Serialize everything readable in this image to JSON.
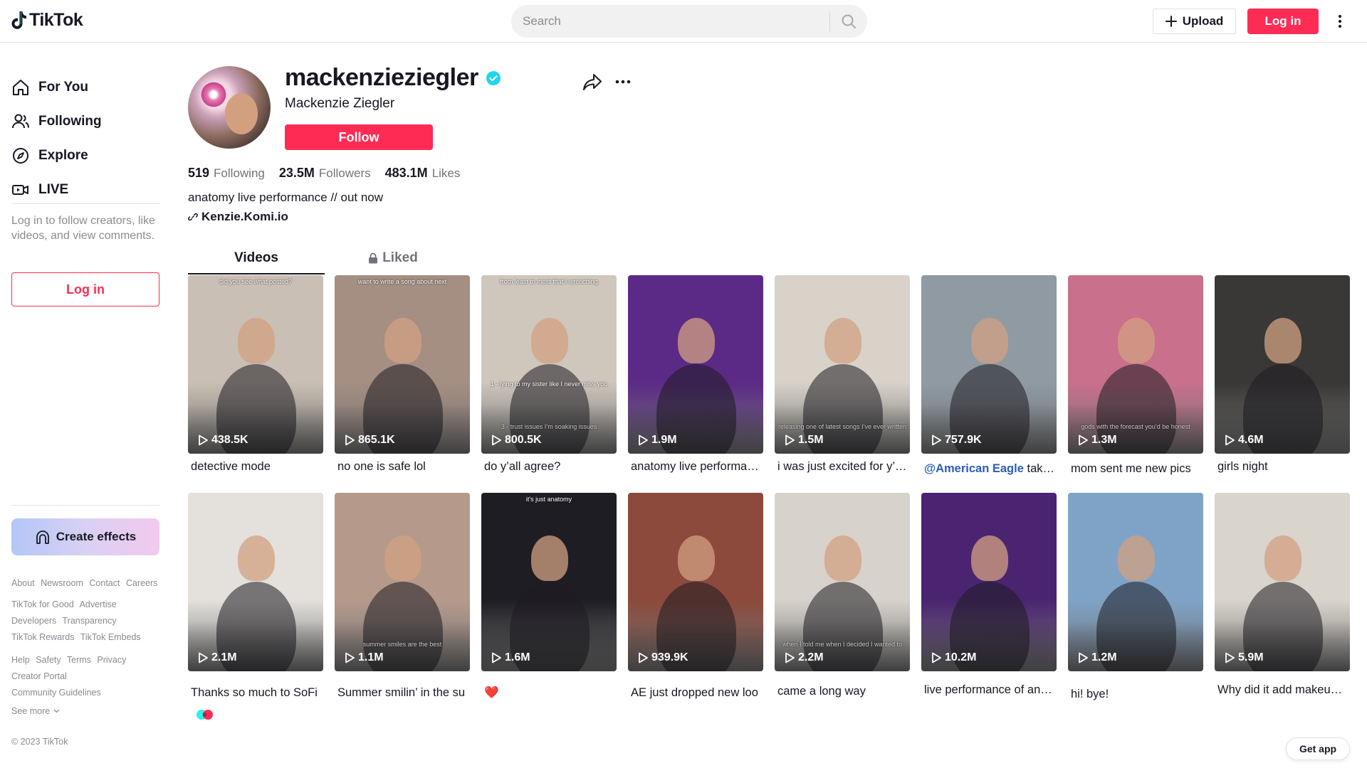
{
  "header": {
    "logo_text": "TikTok",
    "search_placeholder": "Search",
    "upload_label": "Upload",
    "login_label": "Log in"
  },
  "sidebar": {
    "nav": [
      {
        "label": "For You",
        "icon": "home-icon"
      },
      {
        "label": "Following",
        "icon": "people-icon"
      },
      {
        "label": "Explore",
        "icon": "compass-icon"
      },
      {
        "label": "LIVE",
        "icon": "live-icon"
      }
    ],
    "login_note": "Log in to follow creators, like videos, and view comments.",
    "login_label": "Log in",
    "create_effects_label": "Create effects",
    "footer_links_1": [
      "About",
      "Newsroom",
      "Contact",
      "Careers"
    ],
    "footer_links_2": [
      "TikTok for Good",
      "Advertise",
      "Developers",
      "Transparency",
      "TikTok Rewards",
      "TikTok Embeds"
    ],
    "footer_links_3": [
      "Help",
      "Safety",
      "Terms",
      "Privacy",
      "Creator Portal",
      "Community Guidelines"
    ],
    "see_more_label": "See more",
    "copyright": "© 2023 TikTok"
  },
  "profile": {
    "username": "mackenzieziegler",
    "display_name": "Mackenzie Ziegler",
    "follow_label": "Follow",
    "stats": {
      "following_count": "519",
      "following_label": "Following",
      "followers_count": "23.5M",
      "followers_label": "Followers",
      "likes_count": "483.1M",
      "likes_label": "Likes"
    },
    "bio": "anatomy live performance // out now",
    "link": "Kenzie.Komi.io"
  },
  "tabs": {
    "videos_label": "Videos",
    "liked_label": "Liked"
  },
  "videos": [
    {
      "views": "438.5K",
      "caption": "detective mode",
      "bg": "#c9bfb4",
      "overlay_top": "did you see what posted?"
    },
    {
      "views": "865.1K",
      "caption": "no one is safe lol",
      "bg": "#a58e82",
      "overlay_top": "want to write a song about next"
    },
    {
      "views": "800.5K",
      "caption": "do y’all agree?",
      "bg": "#cfc6bc",
      "overlay_top": "from least to most that I wrenching",
      "overlay_mid": "1 - lying to my sister like I never miss you",
      "overlay_bottom": "3 - trust issues I’m soaking issues"
    },
    {
      "views": "1.9M",
      "caption": "anatomy live performa…",
      "bg": "#5b2a87"
    },
    {
      "views": "1.5M",
      "caption": "i was just excited for y’…",
      "bg": "#d8d2c9",
      "overlay_bottom": "releasing one of latest songs I’ve ever written"
    },
    {
      "views": "757.9K",
      "caption_mention": "@American Eagle",
      "caption_rest": " take…",
      "bg": "#8f9aa3"
    },
    {
      "views": "1.3M",
      "caption": "mom sent me new pics",
      "bg": "#c9708d",
      "overlay_bottom": "gods with the forecast you’d be honest"
    },
    {
      "views": "4.6M",
      "caption": "girls night",
      "bg": "#3a3836"
    },
    {
      "views": "2.1M",
      "caption": "Thanks so much to SoFi",
      "bg": "#e4e1dc"
    },
    {
      "views": "1.1M",
      "caption": "Summer smilin’ in the su",
      "bg": "#b59a8c",
      "overlay_bottom": "summer smiles are the best"
    },
    {
      "views": "1.6M",
      "caption": "❤️",
      "bg": "#1f1d24",
      "overlay_top": "it's just anatomy"
    },
    {
      "views": "939.9K",
      "caption": "AE just dropped new loo",
      "bg": "#8c4a3c"
    },
    {
      "views": "2.2M",
      "caption": "came a long way",
      "bg": "#d7d2cb",
      "overlay_bottom": "when I told me when I decided I wanted to"
    },
    {
      "views": "10.2M",
      "caption": "live performance of an…",
      "bg": "#4b2471"
    },
    {
      "views": "1.2M",
      "caption": "hi! bye!",
      "bg": "#7fa3c7"
    },
    {
      "views": "5.9M",
      "caption": "Why did it add makeup…",
      "bg": "#d9d4cc"
    }
  ],
  "get_app_label": "Get app",
  "colors": {
    "brand_red": "#fe2c55",
    "verified_blue": "#20d5ec",
    "text_primary": "#161823",
    "text_secondary": "#73747b"
  }
}
